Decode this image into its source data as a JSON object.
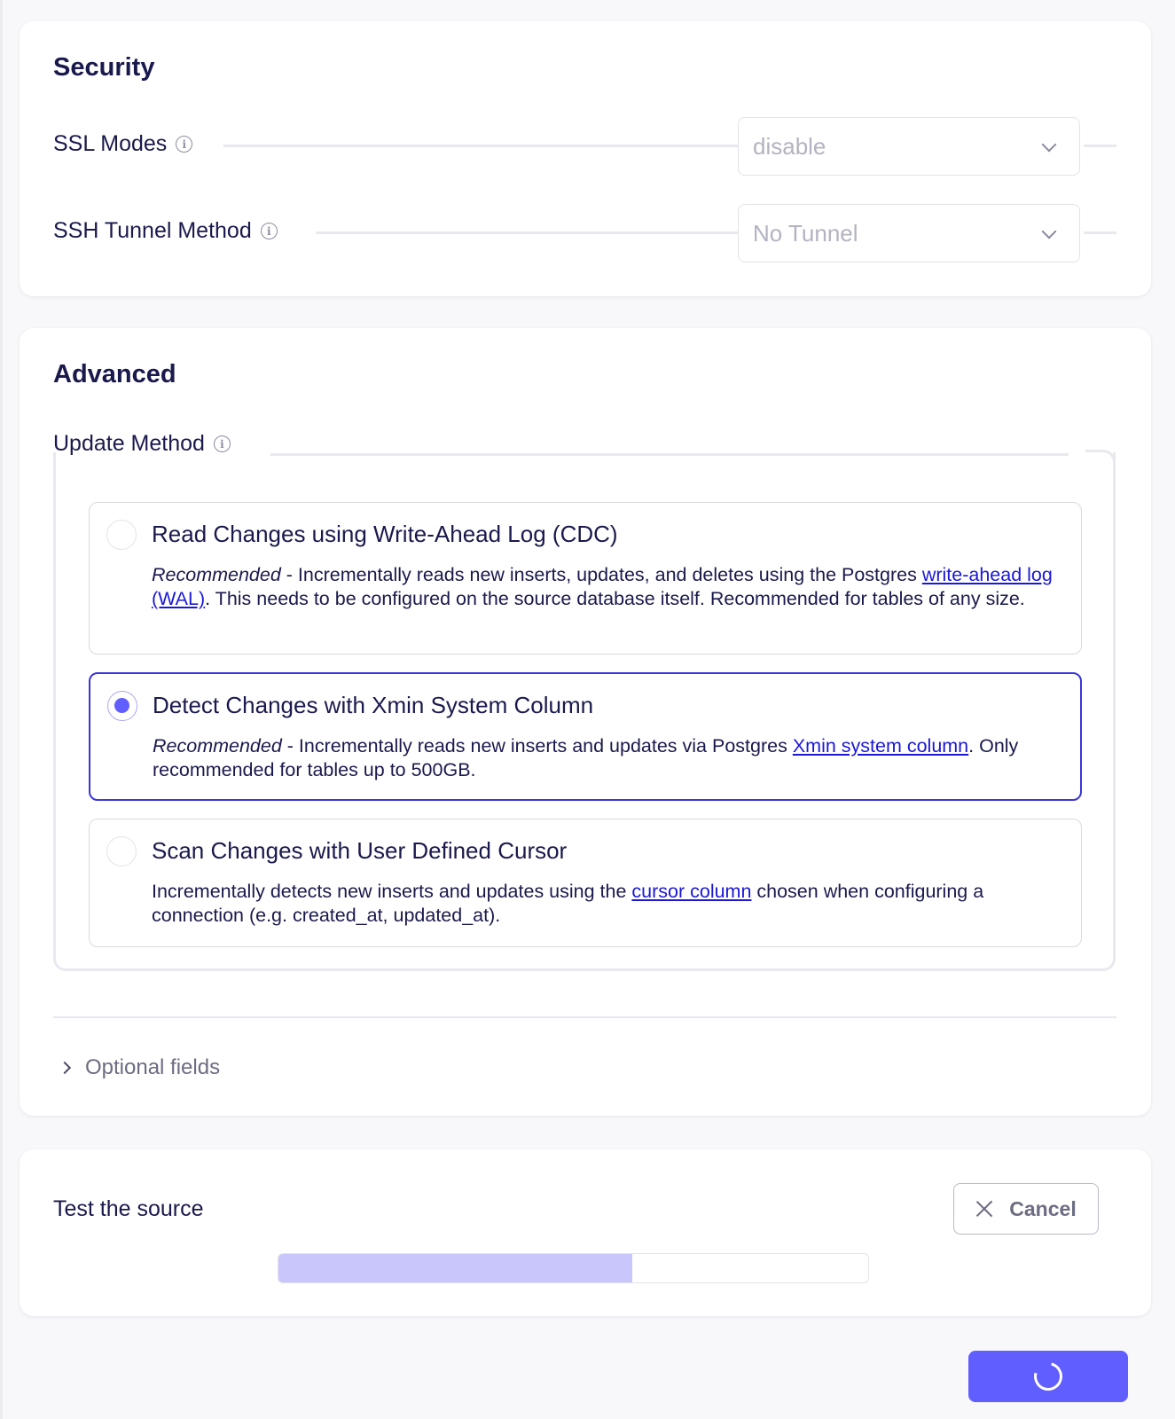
{
  "security": {
    "title": "Security",
    "ssl_modes": {
      "label": "SSL Modes",
      "value": "disable"
    },
    "ssh_tunnel": {
      "label": "SSH Tunnel Method",
      "value": "No Tunnel"
    }
  },
  "advanced": {
    "title": "Advanced",
    "update_method": {
      "label": "Update Method",
      "selected_index": 1,
      "options": [
        {
          "title": "Read Changes using Write-Ahead Log (CDC)",
          "prefix": "Recommended",
          "text_before": " - Incrementally reads new inserts, updates, and deletes using the Postgres ",
          "link": "write-ahead log (WAL)",
          "text_after": ". This needs to be configured on the source database itself. Recommended for tables of any size."
        },
        {
          "title": "Detect Changes with Xmin System Column",
          "prefix": "Recommended",
          "text_before": " - Incrementally reads new inserts and updates via Postgres ",
          "link": "Xmin system column",
          "text_after": ". Only recommended for tables up to 500GB."
        },
        {
          "title": "Scan Changes with User Defined Cursor",
          "prefix": "",
          "text_before": "Incrementally detects new inserts and updates using the ",
          "link": "cursor column",
          "text_after": " chosen when configuring a connection (e.g. created_at, updated_at)."
        }
      ]
    },
    "optional_fields": "Optional fields"
  },
  "test": {
    "title": "Test the source",
    "cancel_label": "Cancel",
    "progress_fraction": 0.6
  },
  "colors": {
    "accent": "#615eff",
    "link": "#1b18d6",
    "selected_border": "#3c36d6",
    "progress_fill": "#c8c6fa"
  },
  "icons": [
    "info-icon",
    "chevron-down-icon",
    "chevron-right-icon",
    "close-icon",
    "spinner-icon"
  ]
}
